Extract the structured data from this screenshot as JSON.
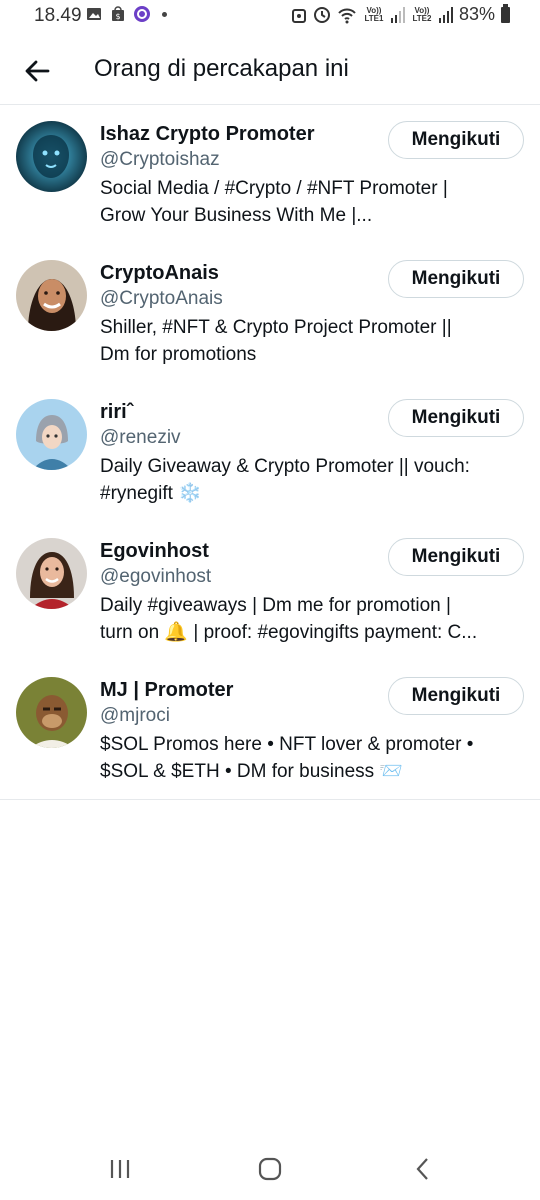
{
  "status_bar": {
    "time": "18.49",
    "battery": "83%",
    "sim1_label": "Vo)) LTE1",
    "sim2_label": "Vo)) LTE2"
  },
  "header": {
    "title": "Orang di percakapan ini"
  },
  "users": [
    {
      "name": "Ishaz Crypto Promoter",
      "handle": "@Cryptoishaz",
      "bio": "Social Media / #Crypto / #NFT Promoter |\nGrow Your Business With Me |...",
      "button": "Mengikuti",
      "avatar_colors": [
        "#0b2a3a",
        "#3aa6c9"
      ]
    },
    {
      "name": "CryptoAnais",
      "handle": "@CryptoAnais",
      "bio": "Shiller, #NFT & Crypto Project Promoter ||\nDm for promotions",
      "button": "Mengikuti",
      "avatar_colors": [
        "#7a5a3c",
        "#d6b08a"
      ]
    },
    {
      "name": "ririˆ",
      "handle": "@reneziv",
      "bio": "Daily Giveaway & Crypto Promoter || vouch:\n#rynegift ❄️",
      "button": "Mengikuti",
      "avatar_colors": [
        "#a9d0ec",
        "#5a8fb8"
      ]
    },
    {
      "name": "Egovinhost",
      "handle": "@egovinhost",
      "bio": "Daily #giveaways | Dm me for promotion |\nturn on 🔔 | proof: #egovingifts payment: C...",
      "button": "Mengikuti",
      "avatar_colors": [
        "#3c2c24",
        "#b8272d"
      ]
    },
    {
      "name": "MJ | Promoter",
      "handle": "@mjroci",
      "bio": "$SOL Promos here • NFT lover & promoter •\n$SOL & $ETH • DM for business 📨",
      "button": "Mengikuti",
      "avatar_colors": [
        "#6b7a2e",
        "#8a5a32"
      ]
    }
  ],
  "nav": {
    "recent_icon": "recent-apps-icon",
    "home_icon": "home-icon",
    "back_icon": "back-nav-icon"
  }
}
